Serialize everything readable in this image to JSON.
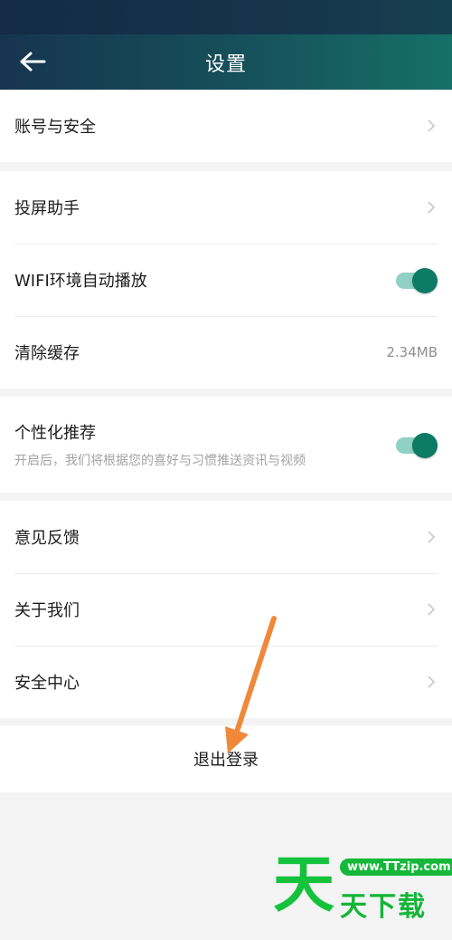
{
  "header": {
    "title": "设置",
    "back_icon": "back-arrow-icon"
  },
  "sections": {
    "account": {
      "label": "账号与安全"
    },
    "cast": {
      "label": "投屏助手"
    },
    "wifi": {
      "label": "WIFI环境自动播放",
      "enabled": true
    },
    "cache": {
      "label": "清除缓存",
      "value": "2.34MB"
    },
    "personalized": {
      "label": "个性化推荐",
      "description": "开启后，我们将根据您的喜好与习惯推送资讯与视频",
      "enabled": true
    },
    "feedback": {
      "label": "意见反馈"
    },
    "about": {
      "label": "关于我们"
    },
    "security_center": {
      "label": "安全中心"
    }
  },
  "logout": {
    "label": "退出登录"
  },
  "watermark": {
    "glyph": "天",
    "url": "www.TTzip.com",
    "text": "天下载"
  },
  "colors": {
    "header_start": "#163450",
    "header_end": "#157068",
    "toggle_on": "#0d7a64",
    "annotation_arrow": "#f0883a",
    "watermark": "#15c23b"
  }
}
